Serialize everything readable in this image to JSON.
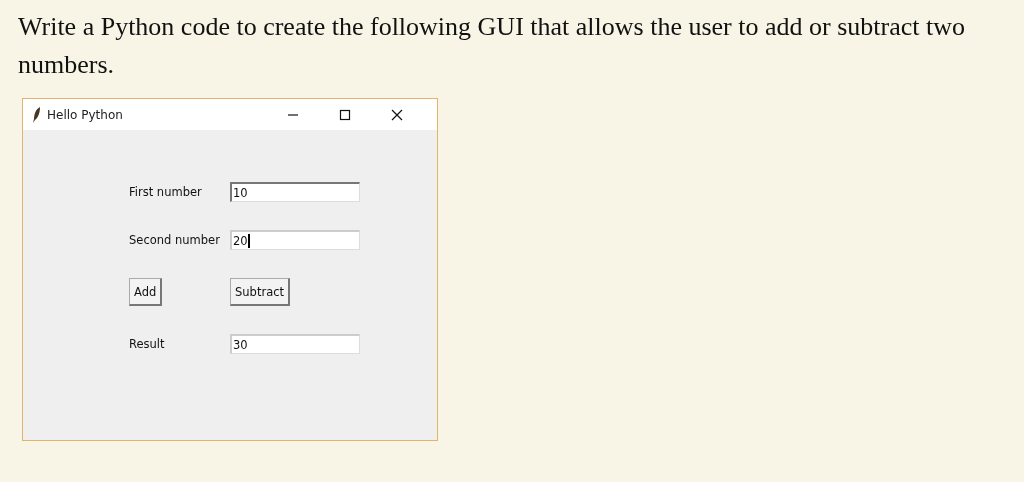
{
  "question": "Write a Python code to create the following GUI that allows the user to add or subtract two numbers.",
  "window": {
    "title": "Hello Python"
  },
  "fields": [
    {
      "label": "First number",
      "value": "10",
      "focused": false
    },
    {
      "label": "Second number",
      "value": "20",
      "focused": true
    }
  ],
  "buttons": [
    "Add",
    "Subtract"
  ],
  "result": {
    "label": "Result",
    "value": "30"
  }
}
